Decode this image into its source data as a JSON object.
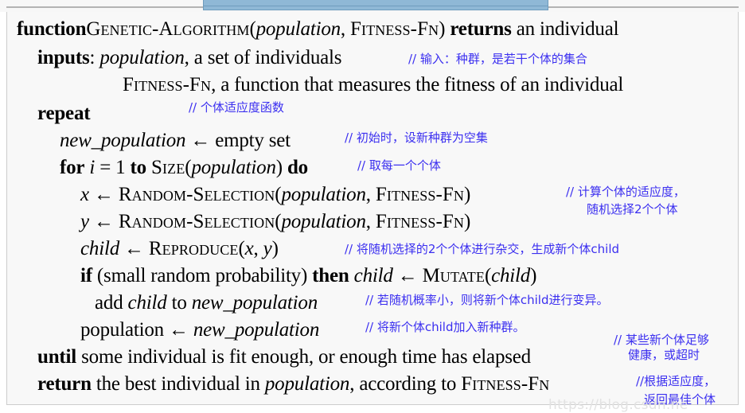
{
  "decor": {
    "blue_bar_color": "#8fb8d6",
    "rule_color": "#b3b3b3",
    "panel_bg": "#f8f8f8",
    "panel_border": "#cccccc"
  },
  "watermark": {
    "text": "https://blog.csdn.ne"
  },
  "pseudocode": {
    "title": "GENETIC-ALGORITHM",
    "lines": [
      {
        "id": "line-function",
        "parts": [
          {
            "kind": "keyword",
            "text": "function"
          },
          {
            "kind": "smallcaps",
            "text": "Genetic-Algorithm"
          },
          {
            "kind": "plain",
            "text": "("
          },
          {
            "kind": "italic",
            "text": "population"
          },
          {
            "kind": "plain",
            "text": ", "
          },
          {
            "kind": "smallcaps",
            "text": "Fitness-Fn"
          },
          {
            "kind": "plain",
            "text": ") "
          },
          {
            "kind": "keyword",
            "text": "returns"
          },
          {
            "kind": "plain",
            "text": " an individual"
          }
        ]
      },
      {
        "id": "line-inputs",
        "parts": [
          {
            "kind": "keyword",
            "text": "inputs"
          },
          {
            "kind": "plain",
            "text": ": "
          },
          {
            "kind": "italic",
            "text": "population"
          },
          {
            "kind": "plain",
            "text": ", a set of individuals"
          }
        ]
      },
      {
        "id": "line-fitnessfn",
        "parts": [
          {
            "kind": "smallcaps",
            "text": "Fitness-Fn"
          },
          {
            "kind": "plain",
            "text": ", a function that measures the fitness of an individual"
          }
        ]
      },
      {
        "id": "line-repeat",
        "parts": [
          {
            "kind": "keyword",
            "text": "repeat"
          }
        ]
      },
      {
        "id": "line-new-population",
        "parts": [
          {
            "kind": "italic",
            "text": "new_population"
          },
          {
            "kind": "plain",
            "text": " ← empty set"
          }
        ]
      },
      {
        "id": "line-for",
        "parts": [
          {
            "kind": "keyword",
            "text": "for"
          },
          {
            "kind": "plain",
            "text": " "
          },
          {
            "kind": "italic",
            "text": "i"
          },
          {
            "kind": "plain",
            "text": " = 1 "
          },
          {
            "kind": "keyword",
            "text": "to"
          },
          {
            "kind": "plain",
            "text": " "
          },
          {
            "kind": "smallcaps",
            "text": "Size"
          },
          {
            "kind": "plain",
            "text": "("
          },
          {
            "kind": "italic",
            "text": "population"
          },
          {
            "kind": "plain",
            "text": ") "
          },
          {
            "kind": "keyword",
            "text": "do"
          }
        ]
      },
      {
        "id": "line-x-select",
        "parts": [
          {
            "kind": "italic",
            "text": "x"
          },
          {
            "kind": "plain",
            "text": " ← "
          },
          {
            "kind": "smallcaps",
            "text": "Random-Selection"
          },
          {
            "kind": "plain",
            "text": "("
          },
          {
            "kind": "italic",
            "text": "population"
          },
          {
            "kind": "plain",
            "text": ", "
          },
          {
            "kind": "smallcaps",
            "text": "Fitness-Fn"
          },
          {
            "kind": "plain",
            "text": ")"
          }
        ]
      },
      {
        "id": "line-y-select",
        "parts": [
          {
            "kind": "italic",
            "text": "y"
          },
          {
            "kind": "plain",
            "text": " ← "
          },
          {
            "kind": "smallcaps",
            "text": "Random-Selection"
          },
          {
            "kind": "plain",
            "text": "("
          },
          {
            "kind": "italic",
            "text": "population"
          },
          {
            "kind": "plain",
            "text": ", "
          },
          {
            "kind": "smallcaps",
            "text": "Fitness-Fn"
          },
          {
            "kind": "plain",
            "text": ")"
          }
        ]
      },
      {
        "id": "line-child-reproduce",
        "parts": [
          {
            "kind": "italic",
            "text": "child"
          },
          {
            "kind": "plain",
            "text": " ← "
          },
          {
            "kind": "smallcaps",
            "text": "Reproduce"
          },
          {
            "kind": "plain",
            "text": "("
          },
          {
            "kind": "italic",
            "text": "x"
          },
          {
            "kind": "plain",
            "text": ", "
          },
          {
            "kind": "italic",
            "text": "y"
          },
          {
            "kind": "plain",
            "text": ")"
          }
        ]
      },
      {
        "id": "line-if-mutate",
        "parts": [
          {
            "kind": "keyword",
            "text": "if"
          },
          {
            "kind": "plain",
            "text": " (small random probability) "
          },
          {
            "kind": "keyword",
            "text": "then"
          },
          {
            "kind": "plain",
            "text": " "
          },
          {
            "kind": "italic",
            "text": "child"
          },
          {
            "kind": "plain",
            "text": " ← "
          },
          {
            "kind": "smallcaps",
            "text": "Mutate"
          },
          {
            "kind": "plain",
            "text": "("
          },
          {
            "kind": "italic",
            "text": "child"
          },
          {
            "kind": "plain",
            "text": ")"
          }
        ]
      },
      {
        "id": "line-add-child",
        "parts": [
          {
            "kind": "plain",
            "text": "add "
          },
          {
            "kind": "italic",
            "text": "child"
          },
          {
            "kind": "plain",
            "text": " to "
          },
          {
            "kind": "italic",
            "text": "new_population"
          }
        ]
      },
      {
        "id": "line-population-assign",
        "parts": [
          {
            "kind": "plain",
            "text": "population ← "
          },
          {
            "kind": "italic",
            "text": "new_population"
          }
        ]
      },
      {
        "id": "line-until",
        "parts": [
          {
            "kind": "keyword",
            "text": "until"
          },
          {
            "kind": "plain",
            "text": " some individual is fit enough, or enough time has elapsed"
          }
        ]
      },
      {
        "id": "line-return",
        "parts": [
          {
            "kind": "keyword",
            "text": "return"
          },
          {
            "kind": "plain",
            "text": " the best individual in "
          },
          {
            "kind": "italic",
            "text": "population"
          },
          {
            "kind": "plain",
            "text": ", according to "
          },
          {
            "kind": "smallcaps",
            "text": "Fitness-Fn"
          }
        ]
      }
    ]
  },
  "annotations": {
    "inputs_note": "// 输入：种群，是若干个体的集合",
    "fitness_note": "// 个体适应度函数",
    "new_population_note": "// 初始时，设新种群为空集",
    "for_note": "// 取每一个个体",
    "selection_note_line1": "// 计算个体的适应度，",
    "selection_note_line2": "随机选择2个个体",
    "reproduce_note": "// 将随机选择的2个个体进行杂交，生成新个体child",
    "mutate_note": "// 若随机概率小，则将新个体child进行变异。",
    "add_child_note": "// 将新个体child加入新种群。",
    "until_note_line1": "// 某些新个体足够",
    "until_note_line2": "健康，或超时",
    "return_note_line1": "//根据适应度，",
    "return_note_line2": "返回最佳个体"
  }
}
